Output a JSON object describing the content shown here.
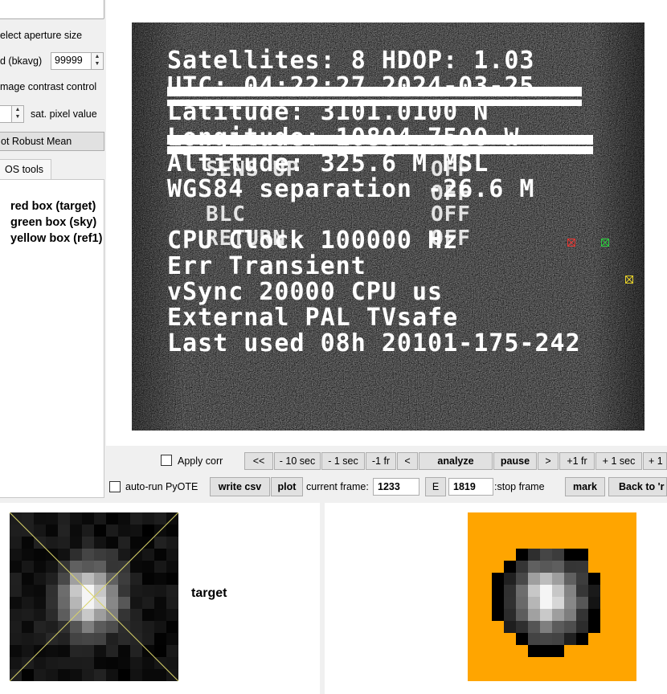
{
  "left_panel": {
    "aperture_label": "elect aperture size",
    "bkavg_label": "d (bkavg)",
    "bkavg_value": "99999",
    "contrast_label": "mage contrast control",
    "sat_label": "sat. pixel value",
    "robust_button": "ot Robust Mean",
    "tab_label": "OS tools",
    "legend": [
      "red box (target)",
      "green box (sky)",
      "yellow box (ref1)"
    ]
  },
  "video": {
    "lines": [
      "Satellites: 8 HDOP: 1.03",
      "UTC: 04:22:27 2024-03-25",
      "Latitude: 3101.0100 N",
      "Longitude: 10804.7500 W",
      "Altitude: 325.6 M MSL",
      "WGS84 separation -26.6 M",
      "CPU Clock 100000 Hz",
      "Err Transient",
      "vSync 20000 CPU us",
      "External PAL TVsafe",
      "Last used 08h 20101-175-242"
    ],
    "ghost_lines": [
      "SENS UP",
      "OFF",
      "OFF",
      "BLC",
      "OFF",
      "RETURN",
      "OFF"
    ],
    "marker_colors": {
      "target": "#e53935",
      "sky": "#2ecc40",
      "ref1": "#e8d22a"
    }
  },
  "controls": {
    "apply_corr_label": "Apply corr",
    "nav": [
      "<<",
      "- 10 sec",
      "- 1 sec",
      "-1 fr",
      "<",
      "analyze",
      "pause",
      ">",
      "+1 fr",
      "+ 1 sec",
      "+ 1"
    ],
    "autorun_label": "auto-run PyOTE",
    "write_csv": "write csv",
    "plot": "plot",
    "current_frame_label": "current frame:",
    "current_frame_value": "1233",
    "e_button": "E",
    "stop_frame_value": "1819",
    "stop_frame_label": ":stop frame",
    "mark": "mark",
    "back_to": "Back to 'r"
  },
  "bottom": {
    "target_label": "target",
    "aperture_bg": "#ffa500"
  }
}
